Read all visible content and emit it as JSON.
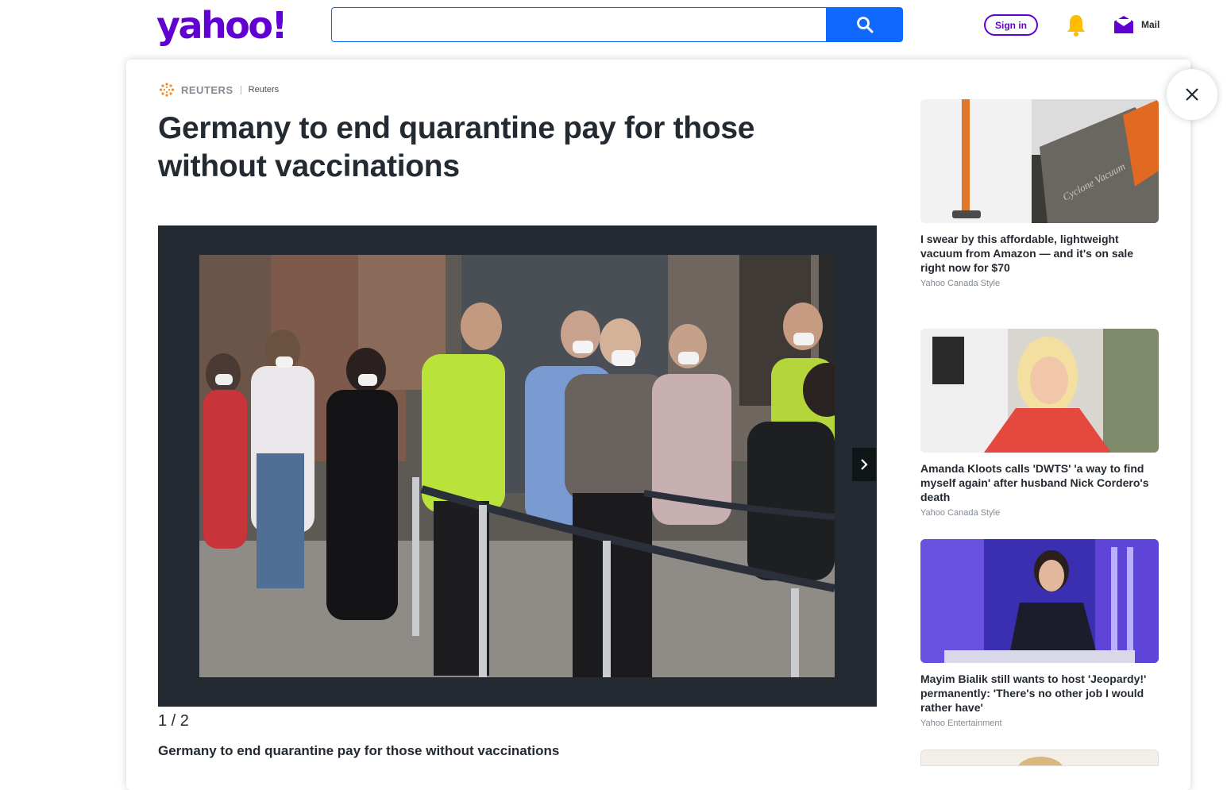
{
  "header": {
    "logo": "yahoo!",
    "search_placeholder": "",
    "signin_label": "Sign in",
    "mail_label": "Mail"
  },
  "article": {
    "provider": "REUTERS",
    "author": "Reuters",
    "headline": "Germany to end quarantine pay for those without vaccinations",
    "slide_counter": "1 / 2",
    "caption": "Germany to end quarantine pay for those without vaccinations"
  },
  "rail": {
    "items": [
      {
        "title": "I swear by this affordable, lightweight vacuum from Amazon — and it's on sale right now for $70",
        "source": "Yahoo Canada Style",
        "thumb_text": "Cyclone Vacuum"
      },
      {
        "title": "Amanda Kloots calls 'DWTS' 'a way to find myself again' after husband Nick Cordero's death",
        "source": "Yahoo Canada Style"
      },
      {
        "title": "Mayim Bialik still wants to host 'Jeopardy!' permanently: 'There's no other job I would rather have'",
        "source": "Yahoo Entertainment"
      }
    ]
  },
  "colors": {
    "brand": "#6001d2",
    "search_blue": "#0f69ff",
    "text": "#232a31",
    "muted": "#828a93",
    "bell": "#ffbc00"
  }
}
